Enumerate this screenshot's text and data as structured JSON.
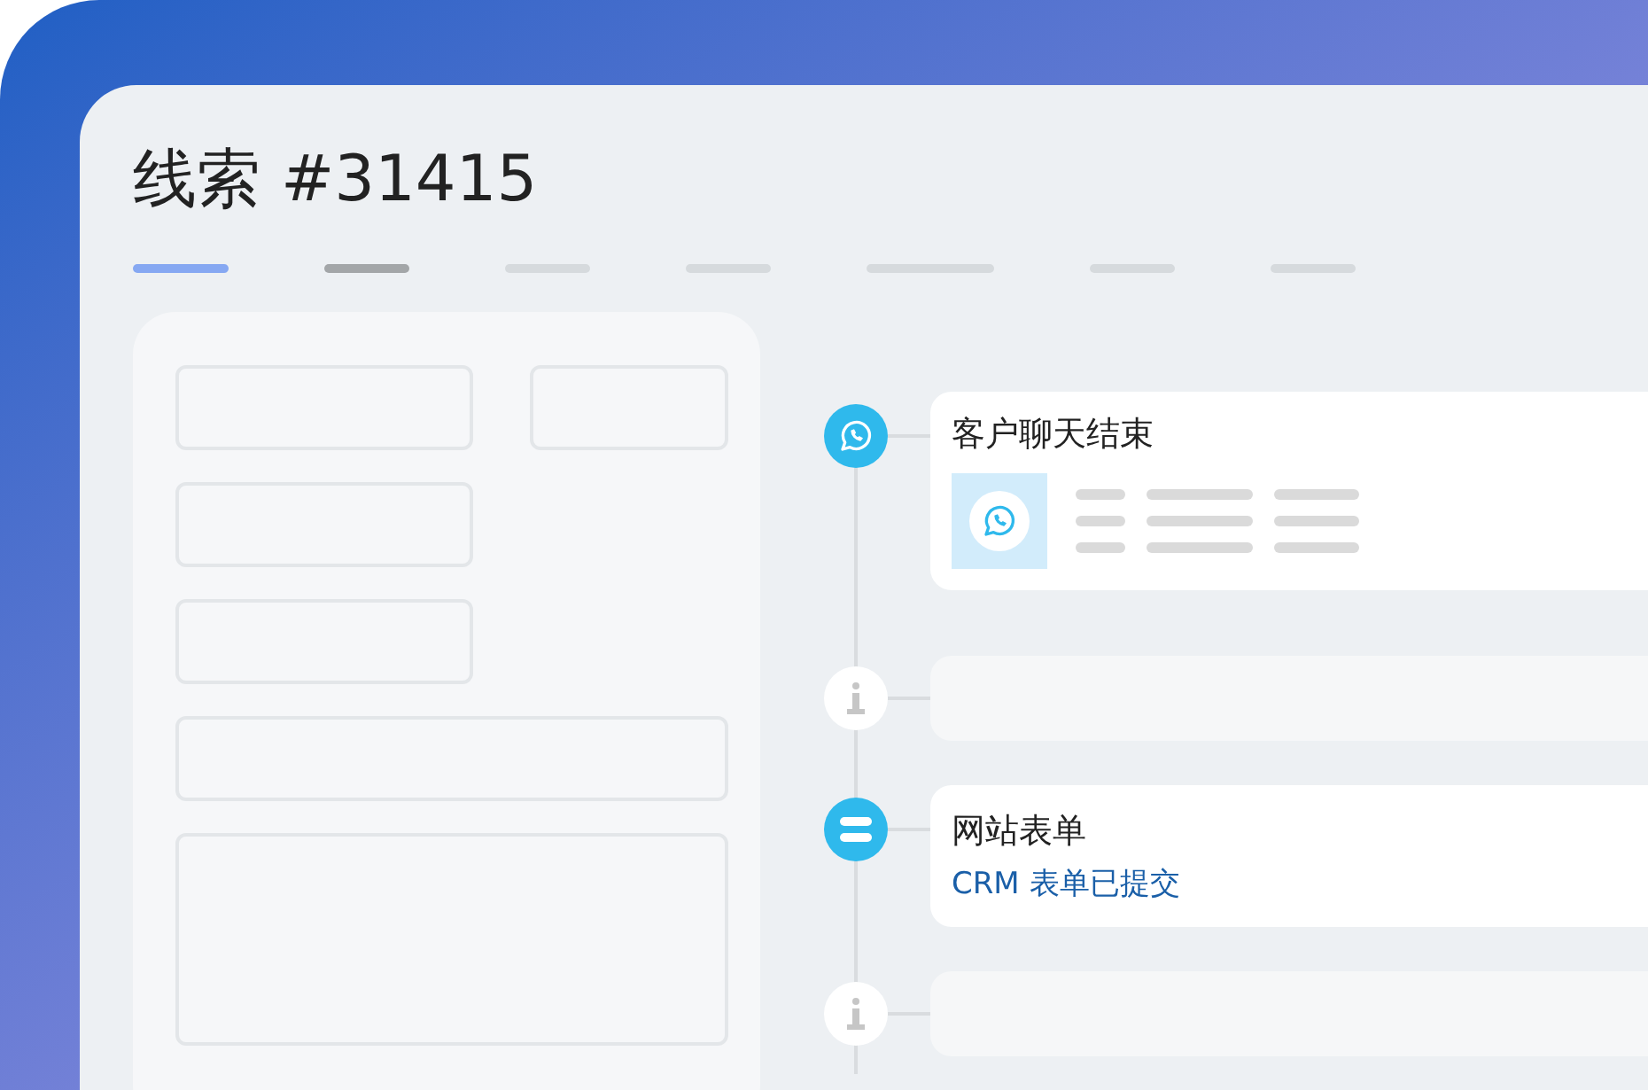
{
  "title": "线索 #31415",
  "tabs": [
    {
      "selected": true,
      "kind": "plain"
    },
    {
      "selected": false,
      "kind": "strong"
    },
    {
      "selected": false,
      "kind": "plain"
    },
    {
      "selected": false,
      "kind": "plain"
    },
    {
      "selected": false,
      "kind": "wide"
    },
    {
      "selected": false,
      "kind": "plain"
    },
    {
      "selected": false,
      "kind": "plain"
    }
  ],
  "form_fields": [
    {
      "kind": "medium-pair"
    },
    {
      "kind": "small"
    },
    {
      "kind": "medium"
    },
    {
      "kind": "medium"
    },
    {
      "kind": "wide"
    },
    {
      "kind": "area"
    }
  ],
  "timeline": [
    {
      "kind": "whatsapp",
      "title": "客户聊天结束"
    },
    {
      "kind": "info"
    },
    {
      "kind": "form",
      "title": "网站表单",
      "subtitle": "CRM 表单已提交"
    },
    {
      "kind": "info"
    }
  ]
}
